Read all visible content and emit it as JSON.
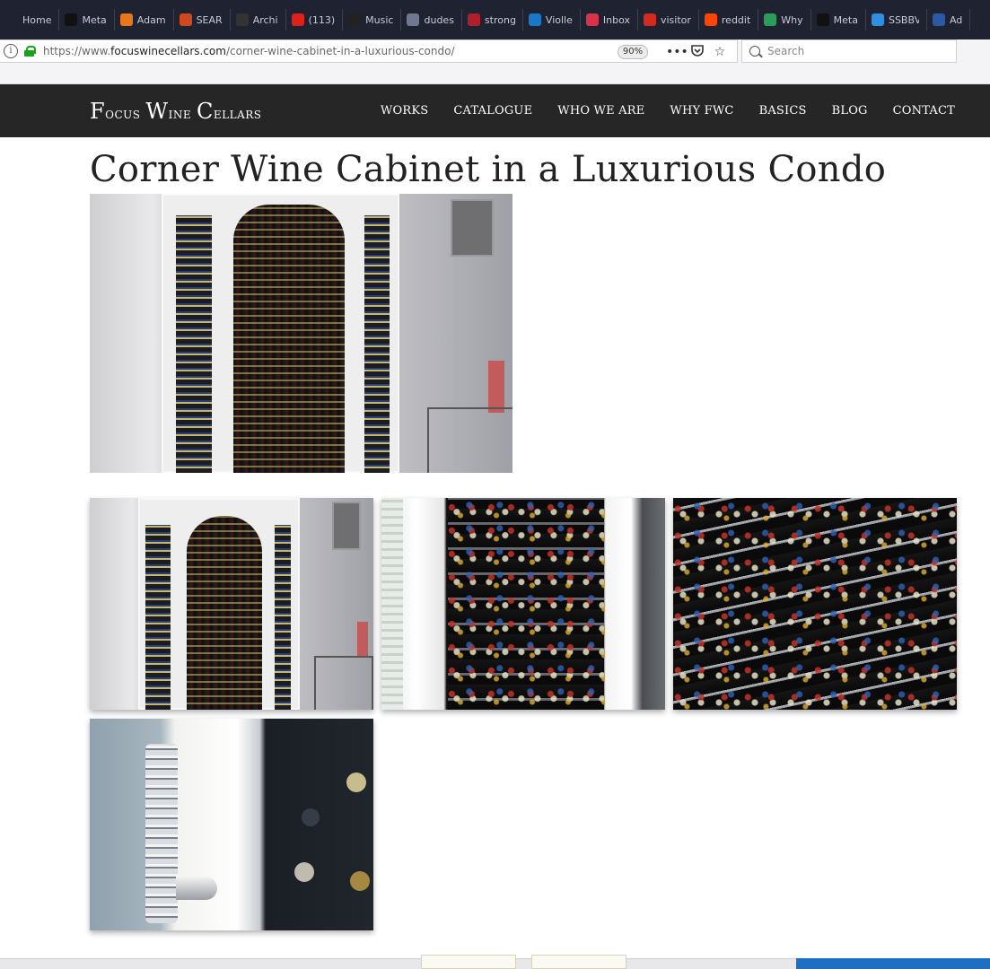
{
  "browser": {
    "bookmarks": [
      {
        "label": "Home",
        "color": "#1f2230"
      },
      {
        "label": "Meta",
        "color": "#111111"
      },
      {
        "label": "Adam",
        "color": "#e8771a"
      },
      {
        "label": "SEAR",
        "color": "#d0481f"
      },
      {
        "label": "Archi",
        "color": "#333333"
      },
      {
        "label": "(113)",
        "color": "#e0201b"
      },
      {
        "label": "Music",
        "color": "#222222"
      },
      {
        "label": "dudes",
        "color": "#6d7891"
      },
      {
        "label": "strong",
        "color": "#b0202c"
      },
      {
        "label": "Violle",
        "color": "#1a78c9"
      },
      {
        "label": "Inbox",
        "color": "#d9334a"
      },
      {
        "label": "visitor",
        "color": "#d52b1e"
      },
      {
        "label": "reddit",
        "color": "#ff4500"
      },
      {
        "label": "Why",
        "color": "#2a9d5a"
      },
      {
        "label": "Meta",
        "color": "#111111"
      },
      {
        "label": "SSBBV",
        "color": "#2f8fe0"
      },
      {
        "label": "Ad",
        "color": "#2b5aa5"
      }
    ],
    "url_prefix": "https://www.",
    "url_domain": "focuswinecellars.com",
    "url_path": "/corner-wine-cabinet-in-a-luxurious-condo/",
    "zoom": "90%",
    "search_placeholder": "Search"
  },
  "site": {
    "logo": {
      "w1_cap": "F",
      "w1_rest": "ocus",
      "w2_cap": "W",
      "w2_rest": "ine",
      "w3_cap": "C",
      "w3_rest": "ellars"
    },
    "nav": [
      "WORKS",
      "CATALOGUE",
      "WHO WE ARE",
      "WHY FWC",
      "BASICS",
      "BLOG",
      "CONTACT"
    ]
  },
  "page": {
    "title": "Corner Wine Cabinet in a Luxurious Condo"
  }
}
